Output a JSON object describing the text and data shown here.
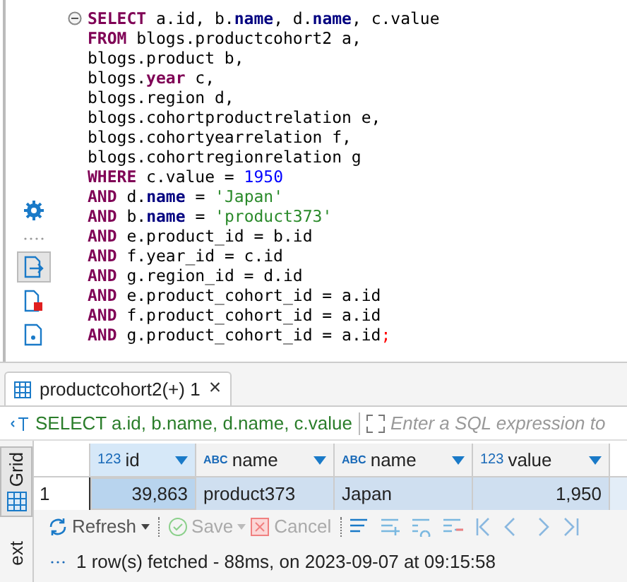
{
  "side_tools": [
    {
      "selected": false
    },
    {
      "selected": true
    },
    {
      "selected": false
    },
    {
      "selected": false
    }
  ],
  "sql_lines": [
    [
      {
        "kind": "keyword",
        "text": "SELECT"
      },
      {
        "kind": "plain",
        "text": " a.id, b."
      },
      {
        "kind": "field",
        "text": "name"
      },
      {
        "kind": "plain",
        "text": ", d."
      },
      {
        "kind": "field",
        "text": "name"
      },
      {
        "kind": "plain",
        "text": ", c.value"
      }
    ],
    [
      {
        "kind": "keyword",
        "text": "FROM"
      },
      {
        "kind": "plain",
        "text": " blogs.productcohort2 a,"
      }
    ],
    [
      {
        "kind": "plain",
        "text": "blogs.product b,"
      }
    ],
    [
      {
        "kind": "plain",
        "text": "blogs."
      },
      {
        "kind": "keyword",
        "text": "year"
      },
      {
        "kind": "plain",
        "text": " c,"
      }
    ],
    [
      {
        "kind": "plain",
        "text": "blogs.region d,"
      }
    ],
    [
      {
        "kind": "plain",
        "text": "blogs.cohortproductrelation e,"
      }
    ],
    [
      {
        "kind": "plain",
        "text": "blogs.cohortyearrelation f,"
      }
    ],
    [
      {
        "kind": "plain",
        "text": "blogs.cohortregionrelation g"
      }
    ],
    [
      {
        "kind": "keyword",
        "text": "WHERE"
      },
      {
        "kind": "plain",
        "text": " c.value = "
      },
      {
        "kind": "number",
        "text": "1950"
      }
    ],
    [
      {
        "kind": "keyword",
        "text": "AND"
      },
      {
        "kind": "plain",
        "text": " d."
      },
      {
        "kind": "field",
        "text": "name"
      },
      {
        "kind": "plain",
        "text": " = "
      },
      {
        "kind": "string",
        "text": "'Japan'"
      }
    ],
    [
      {
        "kind": "keyword",
        "text": "AND"
      },
      {
        "kind": "plain",
        "text": " b."
      },
      {
        "kind": "field",
        "text": "name"
      },
      {
        "kind": "plain",
        "text": " = "
      },
      {
        "kind": "string",
        "text": "'product373'"
      }
    ],
    [
      {
        "kind": "keyword",
        "text": "AND"
      },
      {
        "kind": "plain",
        "text": " e.product_id = b.id"
      }
    ],
    [
      {
        "kind": "keyword",
        "text": "AND"
      },
      {
        "kind": "plain",
        "text": " f.year_id = c.id"
      }
    ],
    [
      {
        "kind": "keyword",
        "text": "AND"
      },
      {
        "kind": "plain",
        "text": " g.region_id = d.id"
      }
    ],
    [
      {
        "kind": "keyword",
        "text": "AND"
      },
      {
        "kind": "plain",
        "text": " e.product_cohort_id = a.id"
      }
    ],
    [
      {
        "kind": "keyword",
        "text": "AND"
      },
      {
        "kind": "plain",
        "text": " f.product_cohort_id = a.id"
      }
    ],
    [
      {
        "kind": "keyword",
        "text": "AND"
      },
      {
        "kind": "plain",
        "text": " g.product_cohort_id = a.id"
      },
      {
        "kind": "punct",
        "text": ";"
      }
    ]
  ],
  "result_tab": {
    "label": "productcohort2(+) 1",
    "close": "×",
    "selected": true
  },
  "filter": {
    "query": "SELECT a.id, b.name, d.name, c.value",
    "placeholder": "Enter a SQL expression to"
  },
  "view_tabs": [
    {
      "label": "Grid",
      "selected": true
    },
    {
      "label": "ext",
      "selected": false
    }
  ],
  "table": {
    "columns": [
      {
        "type": "123",
        "name": "id",
        "selected": true
      },
      {
        "type": "ABC",
        "name": "name",
        "selected": false
      },
      {
        "type": "ABC",
        "name": "name",
        "selected": false
      },
      {
        "type": "123",
        "name": "value",
        "selected": false
      }
    ],
    "rows": [
      {
        "number": "1",
        "cells": [
          {
            "text": "39,863",
            "selected": true
          },
          {
            "text": "product373",
            "selected": false
          },
          {
            "text": "Japan",
            "selected": false
          },
          {
            "text": "1,950",
            "selected": false
          }
        ]
      }
    ]
  },
  "toolbar": [
    {
      "label": "Refresh",
      "disabled": false
    },
    {
      "label": "Save",
      "disabled": true
    },
    {
      "label": "Cancel",
      "disabled": true
    }
  ],
  "status": "1 row(s) fetched - 88ms, on 2023-09-07 at 09:15:58"
}
